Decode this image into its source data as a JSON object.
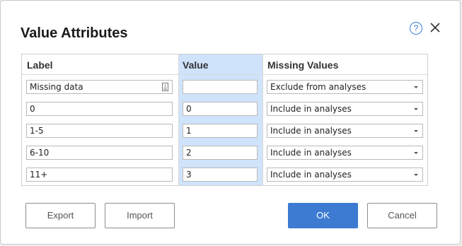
{
  "dialog": {
    "title": "Value Attributes",
    "help_icon": "?",
    "close_icon": "close-icon"
  },
  "table": {
    "headers": {
      "label": "Label",
      "value": "Value",
      "missing": "Missing Values"
    },
    "rows": [
      {
        "label": "Missing data",
        "value": "",
        "missing": "Exclude from analyses"
      },
      {
        "label": "0",
        "value": "0",
        "missing": "Include in analyses"
      },
      {
        "label": "1-5",
        "value": "1",
        "missing": "Include in analyses"
      },
      {
        "label": "6-10",
        "value": "2",
        "missing": "Include in analyses"
      },
      {
        "label": "11+",
        "value": "3",
        "missing": "Include in analyses"
      }
    ]
  },
  "buttons": {
    "export": "Export",
    "import": "Import",
    "ok": "OK",
    "cancel": "Cancel"
  },
  "colors": {
    "accent": "#3c7bd1",
    "value_column_highlight": "#cfe3fb"
  }
}
